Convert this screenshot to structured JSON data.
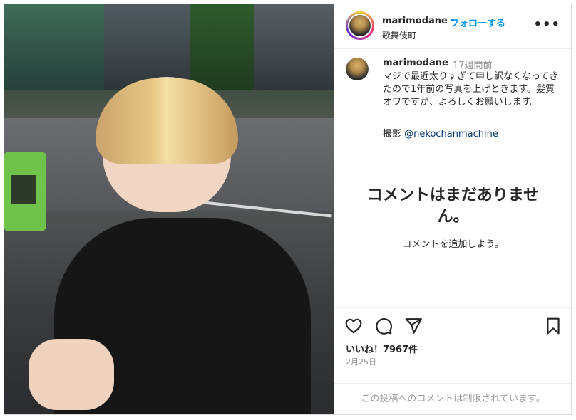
{
  "header": {
    "username": "marimodane",
    "separator": "•",
    "follow_label": "フォローする",
    "location": "歌舞伎町",
    "more_icon": "more-horizontal-icon"
  },
  "caption": {
    "username": "marimodane",
    "time_ago": "17週間前",
    "text": "マジで最近太りすぎて申し訳なくなってきたので1年前の写真を上げときます。髪質オワですが、よろしくお願いします。",
    "credit_label": "撮影",
    "credit_mention": "@nekochanmachine"
  },
  "comments": {
    "empty_title": "コメントはまだありません。",
    "empty_subtitle": "コメントを追加しよう。"
  },
  "actions": {
    "like_icon": "heart-icon",
    "comment_icon": "comment-icon",
    "share_icon": "send-icon",
    "save_icon": "bookmark-icon",
    "likes_text": "いいね！7967件",
    "date": "2月25日"
  },
  "footer": {
    "restricted_text": "この投稿へのコメントは制限されています。"
  },
  "colors": {
    "accent": "#0095f6",
    "mention": "#00376b",
    "muted": "#8e8e8e"
  }
}
